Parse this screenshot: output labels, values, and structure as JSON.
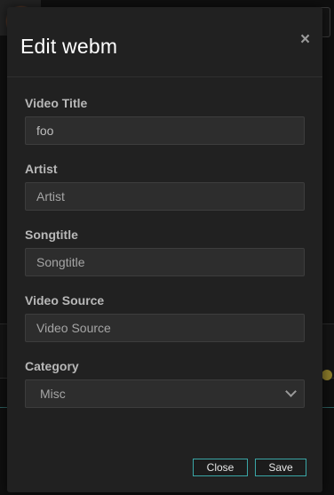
{
  "modal": {
    "title": "Edit webm",
    "close_glyph": "×",
    "fields": {
      "video_title": {
        "label": "Video Title",
        "value": "foo"
      },
      "artist": {
        "label": "Artist",
        "placeholder": "Artist"
      },
      "songtitle": {
        "label": "Songtitle",
        "placeholder": "Songtitle"
      },
      "video_source": {
        "label": "Video Source",
        "placeholder": "Video Source"
      },
      "category": {
        "label": "Category",
        "selected": "Misc"
      }
    },
    "buttons": {
      "close": "Close",
      "save": "Save"
    }
  },
  "colors": {
    "modal_bg": "#212121",
    "input_bg": "#2d2d2d",
    "button_border": "#3aa6a6",
    "title": "#ffffff",
    "label": "#b8b8b8"
  }
}
